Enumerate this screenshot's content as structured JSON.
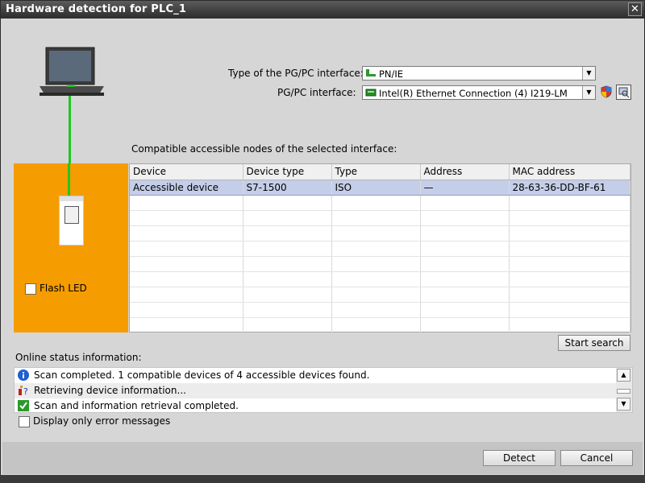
{
  "window": {
    "title": "Hardware detection for PLC_1",
    "close_glyph": "✕"
  },
  "interface": {
    "type_label": "Type of the PG/PC interface:",
    "type_value": "PN/IE",
    "pgpc_label": "PG/PC interface:",
    "pgpc_value": "Intel(R) Ethernet Connection (4) I219-LM"
  },
  "compatible_label": "Compatible accessible nodes of the selected interface:",
  "table": {
    "headers": [
      "Device",
      "Device type",
      "Type",
      "Address",
      "MAC address"
    ],
    "rows": [
      [
        "Accessible device",
        "S7-1500",
        "ISO",
        "—",
        "28-63-36-DD-BF-61"
      ]
    ]
  },
  "flash_led_label": "Flash LED",
  "start_search_label": "Start search",
  "status": {
    "label": "Online status information:",
    "messages": [
      {
        "icon": "info-icon",
        "text": "Scan completed. 1 compatible devices of 4 accessible devices found."
      },
      {
        "icon": "retrieving-icon",
        "text": "Retrieving device information..."
      },
      {
        "icon": "check-icon",
        "text": "Scan and information retrieval completed."
      }
    ],
    "error_only_label": "Display only error messages"
  },
  "footer": {
    "detect_label": "Detect",
    "cancel_label": "Cancel"
  },
  "colors": {
    "panel_orange": "#f59c00",
    "link_green": "#1ec81e",
    "selection": "#c5cee8",
    "info_blue": "#1f5fcf"
  }
}
